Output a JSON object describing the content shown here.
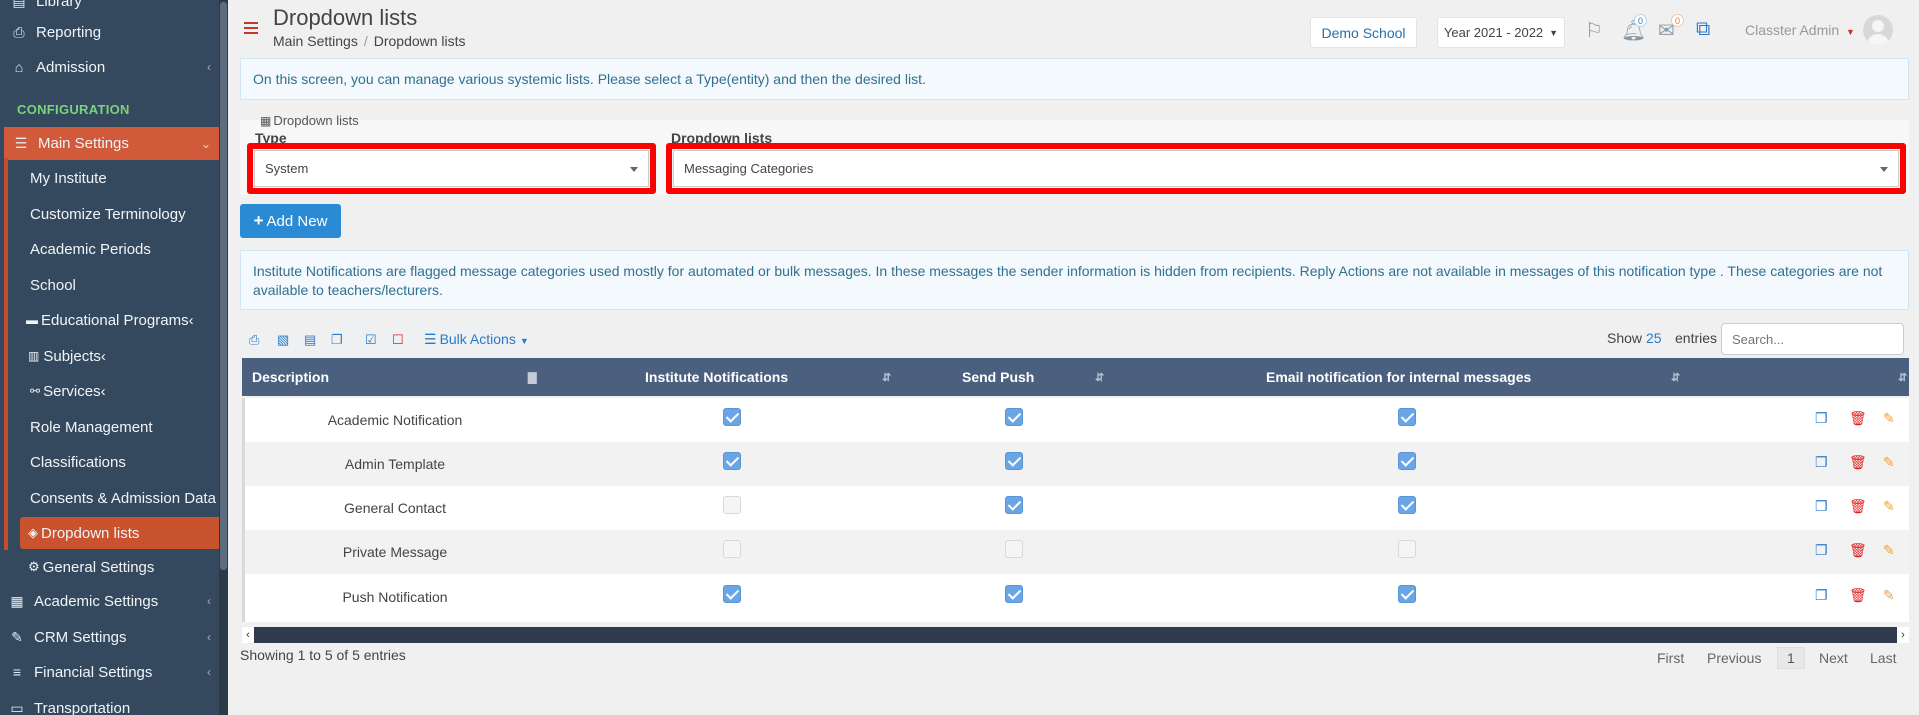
{
  "sidebar": {
    "top_partial": "Library",
    "reporting": "Reporting",
    "admission": "Admission",
    "section": "CONFIGURATION",
    "main_settings": "Main Settings",
    "sub_items": [
      "My Institute",
      "Customize Terminology",
      "Academic Periods",
      "School",
      "Educational Programs",
      "Subjects",
      "Services",
      "Role Management",
      "Classifications",
      "Consents & Admission Data",
      "Dropdown lists",
      "General Settings"
    ],
    "academic_settings": "Academic Settings",
    "crm_settings": "CRM Settings",
    "financial_settings": "Financial Settings",
    "transportation": "Transportation"
  },
  "header": {
    "title": "Dropdown lists",
    "breadcrumb_parent": "Main Settings",
    "breadcrumb_current": "Dropdown lists",
    "school": "Demo School",
    "year": "Year 2021 - 2022",
    "notif_count": "0",
    "mail_count": "0",
    "user": "Classter Admin"
  },
  "info_top": "On this screen, you can manage various systemic lists. Please select a Type(entity) and then the desired list.",
  "panel": {
    "title": "Dropdown lists",
    "type_label": "Type",
    "type_value": "System",
    "list_label": "Dropdown lists",
    "list_value": "Messaging Categories"
  },
  "add_new": "Add New",
  "info_notifications": "Institute Notifications are flagged message categories used mostly for automated or bulk messages. In these messages the sender information is hidden from recipients. Reply Actions are not available in messages of this notification type . These categories are not available to teachers/lecturers.",
  "toolbar": {
    "bulk_actions": "Bulk Actions",
    "show": "Show",
    "page_size": "25",
    "entries": "entries",
    "search_placeholder": "Search..."
  },
  "table": {
    "columns": [
      "Description",
      "Institute Notifications",
      "Send Push",
      "Email notification for internal messages"
    ],
    "rows": [
      {
        "description": "Academic Notification",
        "institute": true,
        "push": true,
        "email": true
      },
      {
        "description": "Admin Template",
        "institute": true,
        "push": true,
        "email": true
      },
      {
        "description": "General Contact",
        "institute": false,
        "push": true,
        "email": true
      },
      {
        "description": "Private Message",
        "institute": false,
        "push": false,
        "email": false
      },
      {
        "description": "Push Notification",
        "institute": true,
        "push": true,
        "email": true
      }
    ]
  },
  "footer": {
    "showing": "Showing 1 to 5 of 5 entries",
    "first": "First",
    "previous": "Previous",
    "page": "1",
    "next": "Next",
    "last": "Last"
  },
  "colors": {
    "accent_red": "#c9482e",
    "sidebar": "#34495e",
    "primary_blue": "#2a8bd4",
    "table_header": "#4b5f7f"
  }
}
